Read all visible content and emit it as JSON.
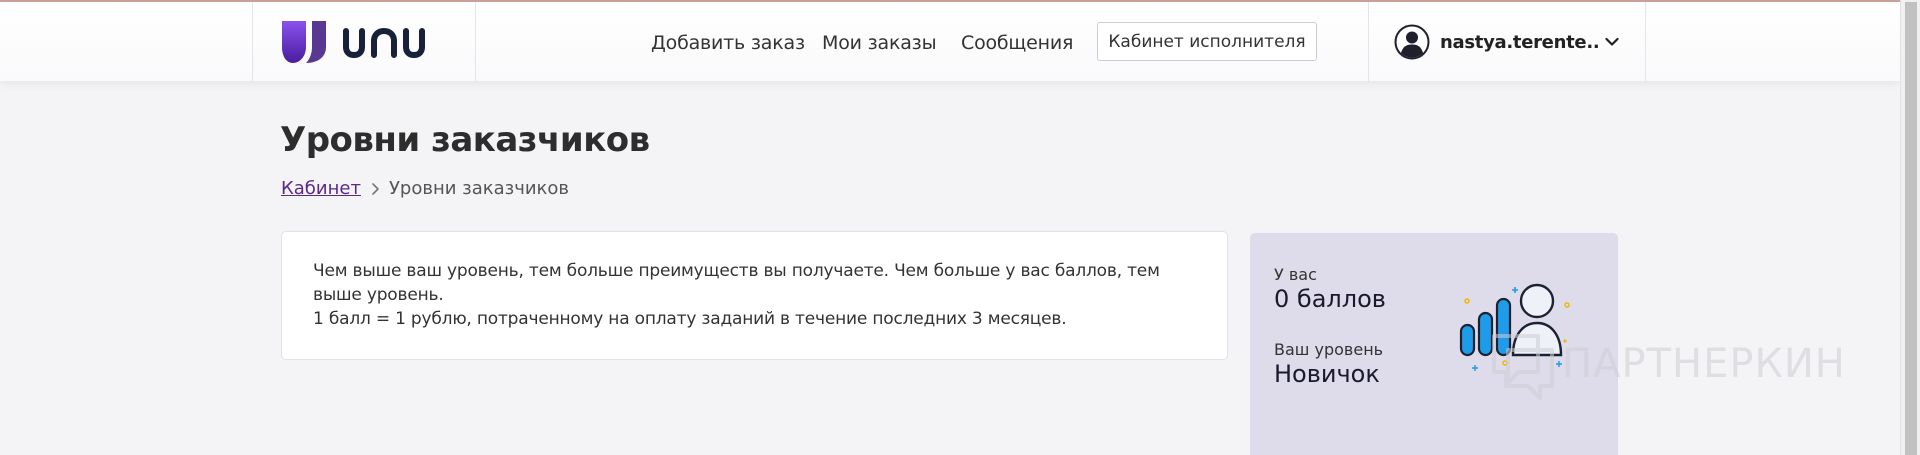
{
  "header": {
    "logo_text": "unu",
    "nav": {
      "add_order": "Добавить заказ",
      "my_orders": "Мои заказы",
      "messages": "Сообщения"
    },
    "cabinet_button": "Кабинет исполнителя",
    "user": {
      "name": "nastya.terente.."
    }
  },
  "page": {
    "title": "Уровни заказчиков",
    "breadcrumb": {
      "link": "Кабинет",
      "current": "Уровни заказчиков"
    }
  },
  "info": {
    "line1": "Чем выше ваш уровень, тем больше преимуществ вы получаете. Чем больше у вас баллов, тем выше уровень.",
    "line2": "1 балл = 1 рублю, потраченному на оплату заданий в течение последних 3 месяцев."
  },
  "level_card": {
    "points_label": "У вас",
    "points_value": "0 баллов",
    "level_label": "Ваш уровень",
    "level_value": "Новичок"
  },
  "watermark": "ПАРТНЕРКИН",
  "colors": {
    "brand_purple": "#5b2a86",
    "logo_gradient_top": "#7b3fe4",
    "logo_gradient_bottom": "#4b1fa0",
    "level_card_bg": "#dedbea",
    "bars_blue": "#1e9be9"
  }
}
